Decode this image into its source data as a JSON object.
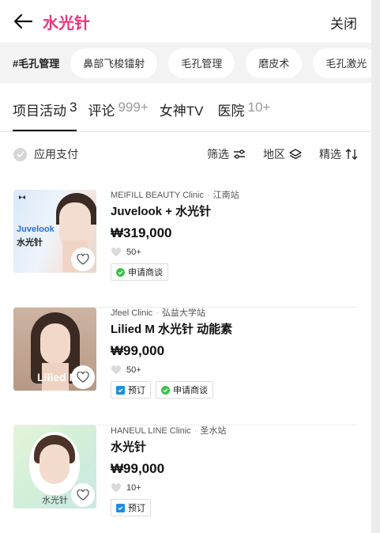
{
  "header": {
    "title": "水光针",
    "close_label": "关闭"
  },
  "chips": {
    "main": "#毛孔管理",
    "items": [
      "鼻部飞梭镭射",
      "毛孔管理",
      "磨皮术",
      "毛孔激光"
    ]
  },
  "tabs": [
    {
      "label": "项目活动",
      "count": "3"
    },
    {
      "label": "评论",
      "count": "999+"
    },
    {
      "label": "女神TV",
      "count": ""
    },
    {
      "label": "医院",
      "count": "10+"
    }
  ],
  "filters": {
    "apply_payment": "应用支付",
    "filter": "筛选",
    "region": "地区",
    "sort": "精选"
  },
  "items": [
    {
      "clinic": "MEIFILL BEAUTY Clinic",
      "location": "江南站",
      "name": "Juvelook + 水光针",
      "price": "₩319,000",
      "likes": "50+",
      "thumb_text_1": "Juvelook",
      "thumb_text_2": "水光针",
      "badges": [
        {
          "label": "申请商谈",
          "kind": "chat"
        }
      ]
    },
    {
      "clinic": "Jfeel Clinic",
      "location": "弘益大学站",
      "name": "Lilied M 水光针 动能素",
      "price": "₩99,000",
      "likes": "50+",
      "thumb_text_1": "Lilied M",
      "thumb_text_2": "",
      "badges": [
        {
          "label": "预订",
          "kind": "reserve"
        },
        {
          "label": "申请商谈",
          "kind": "chat"
        }
      ]
    },
    {
      "clinic": "HANEUL LINE Clinic",
      "location": "圣水站",
      "name": "水光针",
      "price": "₩99,000",
      "likes": "10+",
      "thumb_text_1": "水光针",
      "thumb_text_2": "",
      "badges": [
        {
          "label": "预订",
          "kind": "reserve"
        }
      ]
    }
  ],
  "colors": {
    "accent": "#f0347f",
    "chat": "#3cc14a",
    "reserve": "#1a8fe0"
  }
}
